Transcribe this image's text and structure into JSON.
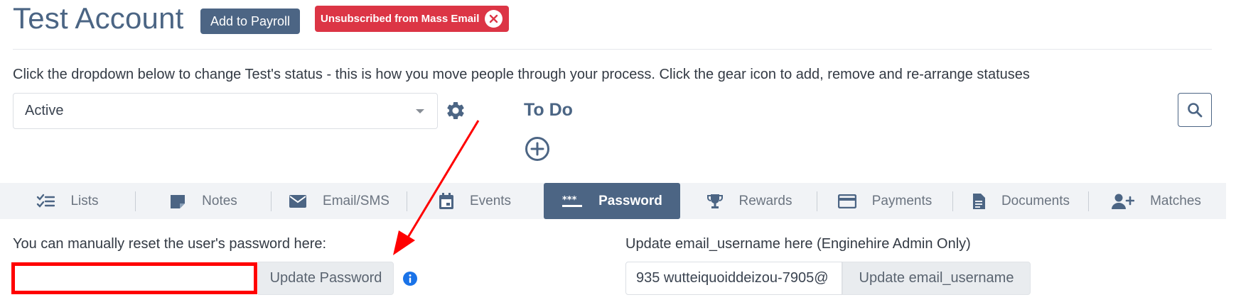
{
  "header": {
    "title": "Test Account",
    "add_payroll_label": "Add to Payroll",
    "unsubscribed_badge": "Unsubscribed from Mass Email",
    "close_icon": "close-circle-icon"
  },
  "status": {
    "help_text": "Click the dropdown below to change Test's status - this is how you move people through your process. Click the gear icon to add, remove and re-arrange statuses",
    "selected": "Active",
    "gear_icon": "gear-icon"
  },
  "todo": {
    "title": "To Do",
    "add_icon": "plus-circle-icon"
  },
  "search": {
    "icon": "search-icon"
  },
  "tabs": [
    {
      "label": "Lists",
      "icon": "checklist-icon"
    },
    {
      "label": "Notes",
      "icon": "note-icon"
    },
    {
      "label": "Email/SMS",
      "icon": "envelope-icon"
    },
    {
      "label": "Events",
      "icon": "calendar-icon"
    },
    {
      "label": "Password",
      "icon": "password-icon",
      "active": true
    },
    {
      "label": "Rewards",
      "icon": "trophy-icon"
    },
    {
      "label": "Payments",
      "icon": "credit-card-icon"
    },
    {
      "label": "Documents",
      "icon": "document-icon"
    },
    {
      "label": "Matches",
      "icon": "user-plus-icon"
    }
  ],
  "password": {
    "label": "You can manually reset the user's password here:",
    "value": "",
    "button": "Update Password",
    "info_icon": "info-icon"
  },
  "email_username": {
    "label": "Update email_username here (Enginehire Admin Only)",
    "value": "935 wutteiquoiddeizou-7905@",
    "button": "Update email_username"
  },
  "colors": {
    "primary": "#4c6584",
    "danger": "#dc3545",
    "highlight": "#ff0000",
    "info": "#1a73e8"
  }
}
